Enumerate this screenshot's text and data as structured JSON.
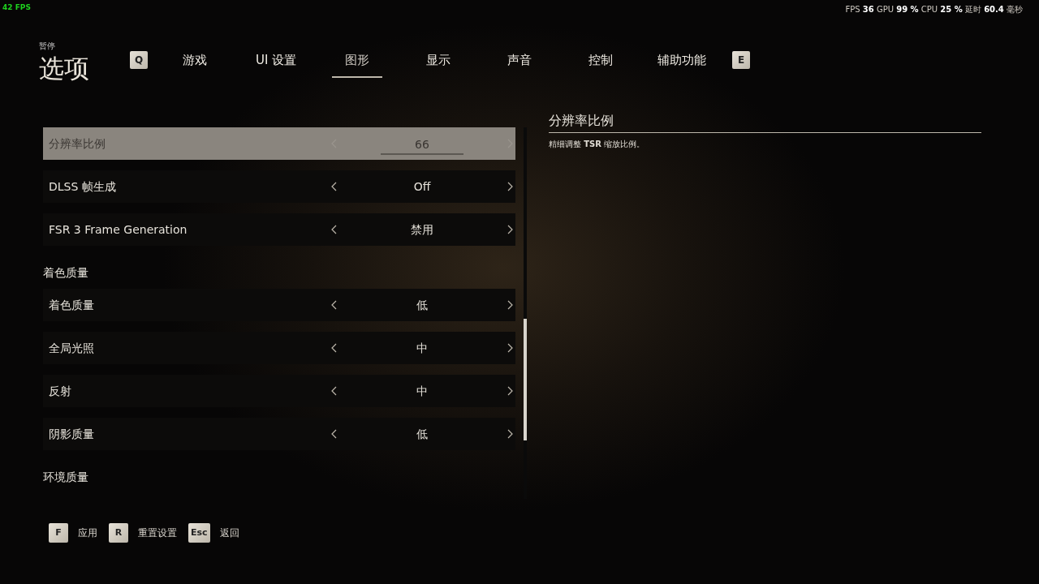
{
  "fps_counter": "42 FPS",
  "perf_stats": "FPS  **36**  GPU **99 %** CPU **25 %** 延时 **60.4** 毫秒",
  "header": {
    "subtitle": "暂停",
    "title": "选项"
  },
  "tabs": {
    "prev_key": "Q",
    "next_key": "E",
    "items": [
      {
        "label": "游戏",
        "selected": false
      },
      {
        "label": "UI 设置",
        "selected": false
      },
      {
        "label": "图形",
        "selected": true
      },
      {
        "label": "显示",
        "selected": false
      },
      {
        "label": "声音",
        "selected": false
      },
      {
        "label": "控制",
        "selected": false
      },
      {
        "label": "辅助功能",
        "selected": false
      }
    ]
  },
  "settings": [
    {
      "kind": "option",
      "label": "分辨率比例",
      "value": "66",
      "selected": true
    },
    {
      "kind": "option",
      "label": "DLSS 帧生成",
      "value": "Off",
      "selected": false
    },
    {
      "kind": "option",
      "label": "FSR 3 Frame Generation",
      "value": "禁用",
      "selected": false
    },
    {
      "kind": "section",
      "label": "着色质量"
    },
    {
      "kind": "option",
      "label": "着色质量",
      "value": "低",
      "selected": false
    },
    {
      "kind": "option",
      "label": "全局光照",
      "value": "中",
      "selected": false
    },
    {
      "kind": "option",
      "label": "反射",
      "value": "中",
      "selected": false
    },
    {
      "kind": "option",
      "label": "阴影质量",
      "value": "低",
      "selected": false
    },
    {
      "kind": "section",
      "label": "环境质量"
    }
  ],
  "detail": {
    "title": "分辨率比例",
    "description": "精细调整 **TSR** 缩放比例。"
  },
  "footer_hints": [
    {
      "key": "F",
      "label": "应用"
    },
    {
      "key": "R",
      "label": "重置设置"
    },
    {
      "key": "Esc",
      "label": "返回"
    }
  ]
}
